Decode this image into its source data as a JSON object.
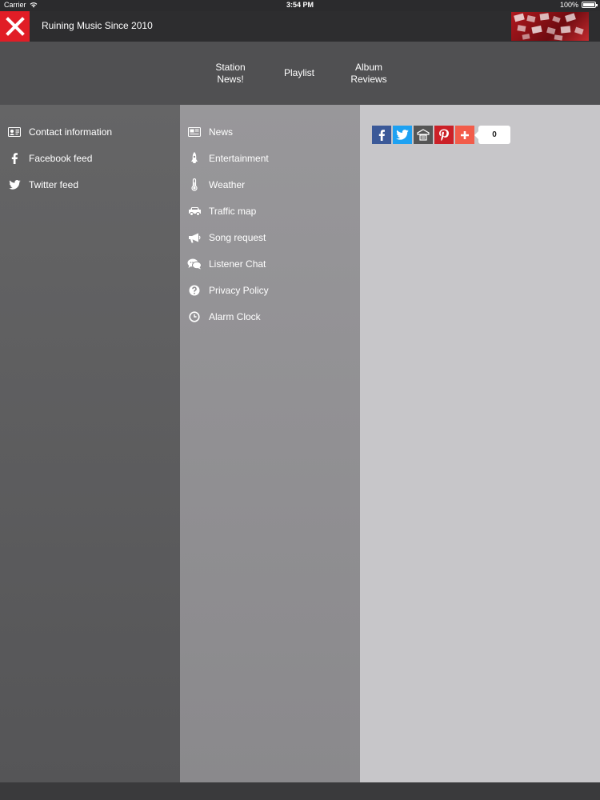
{
  "status_bar": {
    "carrier": "Carrier",
    "time": "3:54 PM",
    "battery": "100%"
  },
  "header": {
    "title": "Ruining Music Since 2010"
  },
  "top_nav": [
    {
      "label_line1": "Station",
      "label_line2": "News!"
    },
    {
      "label_line1": "Playlist",
      "label_line2": ""
    },
    {
      "label_line1": "Album",
      "label_line2": "Reviews"
    }
  ],
  "left_menu": [
    {
      "label": "Contact information",
      "icon": "contact-card-icon"
    },
    {
      "label": "Facebook feed",
      "icon": "facebook-icon"
    },
    {
      "label": "Twitter feed",
      "icon": "twitter-icon"
    }
  ],
  "mid_menu": [
    {
      "label": "News",
      "icon": "newspaper-icon"
    },
    {
      "label": "Entertainment",
      "icon": "rocket-icon"
    },
    {
      "label": "Weather",
      "icon": "thermometer-icon"
    },
    {
      "label": "Traffic map",
      "icon": "car-icon"
    },
    {
      "label": "Song request",
      "icon": "megaphone-icon"
    },
    {
      "label": "Listener Chat",
      "icon": "chat-icon"
    },
    {
      "label": "Privacy Policy",
      "icon": "question-icon"
    },
    {
      "label": "Alarm Clock",
      "icon": "clock-icon"
    }
  ],
  "share": {
    "count": "0",
    "buttons": [
      {
        "name": "facebook",
        "color": "#3b5998"
      },
      {
        "name": "twitter",
        "color": "#1da1f2"
      },
      {
        "name": "print",
        "color": "#555555"
      },
      {
        "name": "pinterest",
        "color": "#cb2027"
      },
      {
        "name": "more",
        "color": "#f25c4a"
      }
    ]
  },
  "colors": {
    "accent": "#e11d26"
  }
}
